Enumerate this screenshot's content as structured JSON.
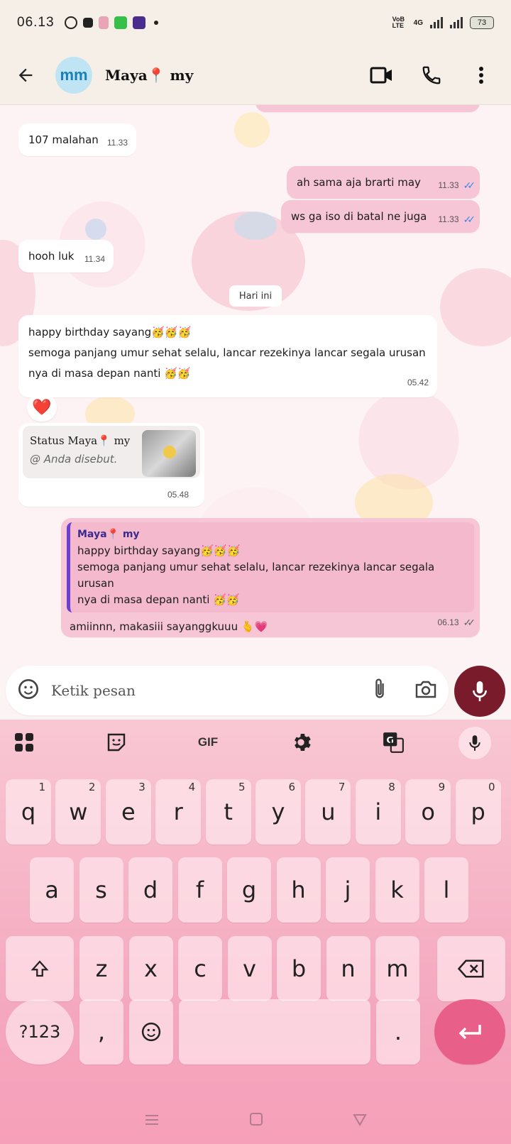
{
  "status_bar": {
    "time": "06.13",
    "network_label": "VoB LTE",
    "network_type": "4G",
    "battery": "73"
  },
  "header": {
    "avatar_initials": "mm",
    "contact_name": "Maya📍 my"
  },
  "messages": [
    {
      "direction": "in",
      "text": "107 malahan",
      "time": "11.33"
    },
    {
      "direction": "out",
      "text": "ah sama aja brarti may",
      "time": "11.33",
      "status": "read"
    },
    {
      "direction": "out",
      "text": "ws ga iso di batal ne juga",
      "time": "11.33",
      "status": "read"
    },
    {
      "direction": "in",
      "text": "hooh luk",
      "time": "11.34"
    },
    {
      "direction": "in",
      "lines": [
        "happy birthday sayang🥳🥳🥳",
        "semoga panjang umur sehat selalu, lancar rezekinya lancar segala urusan",
        "nya di masa depan nanti 🥳🥳"
      ],
      "time": "05.42",
      "reaction": "❤️"
    },
    {
      "direction": "in",
      "status_title": "Status Maya📍 my",
      "status_sub": "@ Anda disebut.",
      "time": "05.48"
    },
    {
      "direction": "out",
      "quote_name": "Maya📍 my",
      "quote_lines": [
        "happy birthday sayang🥳🥳🥳",
        "semoga panjang umur sehat selalu, lancar rezekinya lancar segala urusan",
        "nya di masa depan nanti 🥳🥳"
      ],
      "text": "amiinnn, makasiii sayanggkuuu 🫰💗",
      "time": "06.13",
      "status": "delivered"
    }
  ],
  "date_divider": "Hari ini",
  "input": {
    "placeholder": "Ketik pesan"
  },
  "keyboard": {
    "toolbar_gif": "GIF",
    "row1": [
      {
        "k": "q",
        "h": "1"
      },
      {
        "k": "w",
        "h": "2"
      },
      {
        "k": "e",
        "h": "3"
      },
      {
        "k": "r",
        "h": "4"
      },
      {
        "k": "t",
        "h": "5"
      },
      {
        "k": "y",
        "h": "6"
      },
      {
        "k": "u",
        "h": "7"
      },
      {
        "k": "i",
        "h": "8"
      },
      {
        "k": "o",
        "h": "9"
      },
      {
        "k": "p",
        "h": "0"
      }
    ],
    "row2": [
      "a",
      "s",
      "d",
      "f",
      "g",
      "h",
      "j",
      "k",
      "l"
    ],
    "row3": [
      "z",
      "x",
      "c",
      "v",
      "b",
      "n",
      "m"
    ],
    "symbols": "?123",
    "comma": ",",
    "period": "."
  },
  "icons": {
    "back": "back-arrow-icon",
    "video": "video-call-icon",
    "call": "phone-icon",
    "menu": "more-vert-icon",
    "sticker": "sticker-icon",
    "attach": "attach-icon",
    "camera": "camera-icon",
    "mic": "mic-icon"
  }
}
